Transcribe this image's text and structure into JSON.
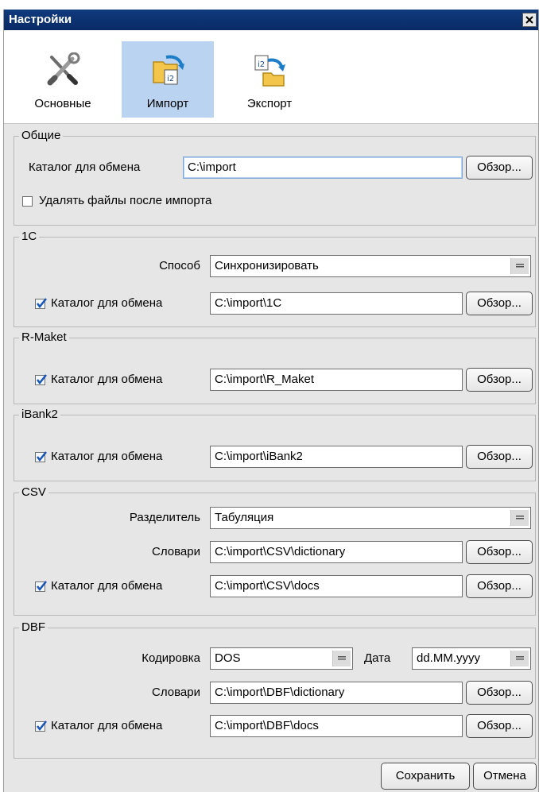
{
  "window": {
    "title": "Настройки"
  },
  "tabs": [
    {
      "label": "Основные",
      "icon": "wrench-screwdriver-icon"
    },
    {
      "label": "Импорт",
      "icon": "folder-import-icon"
    },
    {
      "label": "Экспорт",
      "icon": "folder-export-icon"
    }
  ],
  "general": {
    "title": "Общие",
    "exchange_label": "Каталог для обмена",
    "exchange_value": "C:\\import",
    "browse": "Обзор...",
    "delete_files_label": "Удалять файлы после импорта"
  },
  "onec": {
    "title": "1С",
    "method_label": "Способ",
    "method_value": "Синхронизировать",
    "exchange_label": "Каталог для обмена",
    "exchange_value": "C:\\import\\1C",
    "browse": "Обзор..."
  },
  "rmaket": {
    "title": "R-Maket",
    "exchange_label": "Каталог для обмена",
    "exchange_value": "C:\\import\\R_Maket",
    "browse": "Обзор..."
  },
  "ibank2": {
    "title": "iBank2",
    "exchange_label": "Каталог для обмена",
    "exchange_value": "C:\\import\\iBank2",
    "browse": "Обзор..."
  },
  "csv": {
    "title": "CSV",
    "separator_label": "Разделитель",
    "separator_value": "Табуляция",
    "dict_label": "Словари",
    "dict_value": "C:\\import\\CSV\\dictionary",
    "exchange_label": "Каталог для обмена",
    "exchange_value": "C:\\import\\CSV\\docs",
    "browse": "Обзор..."
  },
  "dbf": {
    "title": "DBF",
    "encoding_label": "Кодировка",
    "encoding_value": "DOS",
    "date_label": "Дата",
    "date_value": "dd.MM.yyyy",
    "dict_label": "Словари",
    "dict_value": "C:\\import\\DBF\\dictionary",
    "exchange_label": "Каталог для обмена",
    "exchange_value": "C:\\import\\DBF\\docs",
    "browse": "Обзор..."
  },
  "buttons": {
    "save": "Сохранить",
    "cancel": "Отмена"
  }
}
